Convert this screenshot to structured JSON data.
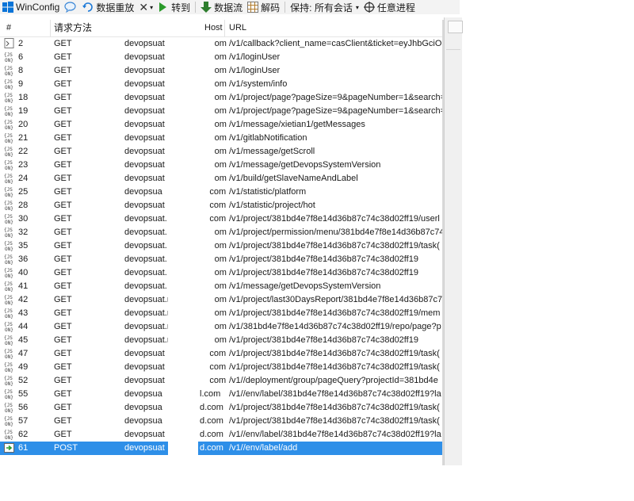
{
  "toolbar": {
    "winconfig": "WinConfig",
    "replay": "数据重放",
    "goto": "转到",
    "stream": "数据流",
    "decode": "解码",
    "keep": "保持: 所有会话",
    "process": "任意进程"
  },
  "columns": {
    "num": "#",
    "method": "请求方法",
    "host": "Host",
    "url": "URL"
  },
  "rows": [
    {
      "id": "2",
      "method": "GET",
      "host": "devopsuat",
      "host_tail": "om",
      "url": "/v1/callback?client_name=casClient&ticket=eyJhbGciOiJ",
      "icon": "page-icon"
    },
    {
      "id": "6",
      "method": "GET",
      "host": "devopsuat",
      "host_tail": "om",
      "url": "/v1/loginUser",
      "icon": "json-icon"
    },
    {
      "id": "8",
      "method": "GET",
      "host": "devopsuat",
      "host_tail": "om",
      "url": "/v1/loginUser",
      "icon": "json-icon"
    },
    {
      "id": "9",
      "method": "GET",
      "host": "devopsuat",
      "host_tail": "om",
      "url": "/v1/system/info",
      "icon": "json-icon"
    },
    {
      "id": "18",
      "method": "GET",
      "host": "devopsuat",
      "host_tail": "om",
      "url": "/v1/project/page?pageSize=9&pageNumber=1&search=",
      "icon": "json-icon"
    },
    {
      "id": "19",
      "method": "GET",
      "host": "devopsuat",
      "host_tail": "om",
      "url": "/v1/project/page?pageSize=9&pageNumber=1&search=",
      "icon": "json-icon"
    },
    {
      "id": "20",
      "method": "GET",
      "host": "devopsuat",
      "host_tail": "om",
      "url": "/v1/message/xietian1/getMessages",
      "icon": "json-icon"
    },
    {
      "id": "21",
      "method": "GET",
      "host": "devopsuat",
      "host_tail": "om",
      "url": "/v1/gitlabNotification",
      "icon": "json-icon"
    },
    {
      "id": "22",
      "method": "GET",
      "host": "devopsuat",
      "host_tail": "om",
      "url": "/v1/message/getScroll",
      "icon": "json-icon"
    },
    {
      "id": "23",
      "method": "GET",
      "host": "devopsuat",
      "host_tail": "om",
      "url": "/v1/message/getDevopsSystemVersion",
      "icon": "json-icon"
    },
    {
      "id": "24",
      "method": "GET",
      "host": "devopsuat",
      "host_tail": "om",
      "url": "/v1/build/getSlaveNameAndLabel",
      "icon": "json-icon"
    },
    {
      "id": "25",
      "method": "GET",
      "host": "devopsua",
      "host_tail": "com",
      "url": "/v1/statistic/platform",
      "icon": "json-icon"
    },
    {
      "id": "28",
      "method": "GET",
      "host": "devopsuat",
      "host_tail": "com",
      "url": "/v1/statistic/project/hot",
      "icon": "json-icon"
    },
    {
      "id": "30",
      "method": "GET",
      "host": "devopsuat.",
      "host_tail": "com",
      "url": "/v1/project/381bd4e7f8e14d36b87c74c38d02ff19/userl",
      "icon": "json-icon"
    },
    {
      "id": "32",
      "method": "GET",
      "host": "devopsuat.",
      "host_tail": "om",
      "url": "/v1/project/permission/menu/381bd4e7f8e14d36b87c74",
      "icon": "json-icon"
    },
    {
      "id": "35",
      "method": "GET",
      "host": "devopsuat.",
      "host_tail": "om",
      "url": "/v1/project/381bd4e7f8e14d36b87c74c38d02ff19/task(",
      "icon": "json-icon"
    },
    {
      "id": "36",
      "method": "GET",
      "host": "devopsuat.",
      "host_tail": "om",
      "url": "/v1/project/381bd4e7f8e14d36b87c74c38d02ff19",
      "icon": "json-icon"
    },
    {
      "id": "40",
      "method": "GET",
      "host": "devopsuat.",
      "host_tail": "om",
      "url": "/v1/project/381bd4e7f8e14d36b87c74c38d02ff19",
      "icon": "json-icon"
    },
    {
      "id": "41",
      "method": "GET",
      "host": "devopsuat.",
      "host_tail": "om",
      "url": "/v1/message/getDevopsSystemVersion",
      "icon": "json-icon"
    },
    {
      "id": "42",
      "method": "GET",
      "host": "devopsuat.m",
      "host_tail": "om",
      "url": "/v1/project/last30DaysReport/381bd4e7f8e14d36b87c7",
      "icon": "json-icon"
    },
    {
      "id": "43",
      "method": "GET",
      "host": "devopsuat.m",
      "host_tail": "om",
      "url": "/v1/project/381bd4e7f8e14d36b87c74c38d02ff19/mem",
      "icon": "json-icon"
    },
    {
      "id": "44",
      "method": "GET",
      "host": "devopsuat.m",
      "host_tail": "om",
      "url": "/v1/381bd4e7f8e14d36b87c74c38d02ff19/repo/page?p",
      "icon": "json-icon"
    },
    {
      "id": "45",
      "method": "GET",
      "host": "devopsuat.m",
      "host_tail": "om",
      "url": "/v1/project/381bd4e7f8e14d36b87c74c38d02ff19",
      "icon": "json-icon"
    },
    {
      "id": "47",
      "method": "GET",
      "host": "devopsuat",
      "host_tail": "com",
      "url": "/v1/project/381bd4e7f8e14d36b87c74c38d02ff19/task(",
      "icon": "json-icon"
    },
    {
      "id": "49",
      "method": "GET",
      "host": "devopsuat",
      "host_tail": "com",
      "url": "/v1/project/381bd4e7f8e14d36b87c74c38d02ff19/task(",
      "icon": "json-icon"
    },
    {
      "id": "52",
      "method": "GET",
      "host": "devopsuat",
      "host_tail": "com",
      "url": "/v1//deployment/group/pageQuery?projectId=381bd4e",
      "icon": "json-icon"
    },
    {
      "id": "55",
      "method": "GET",
      "host": "devopsua",
      "host_tail": "l.com",
      "url": "/v1//env/label/381bd4e7f8e14d36b87c74c38d02ff19?la",
      "icon": "json-icon"
    },
    {
      "id": "56",
      "method": "GET",
      "host": "devopsua",
      "host_tail": "d.com",
      "url": "/v1/project/381bd4e7f8e14d36b87c74c38d02ff19/task(",
      "icon": "json-icon"
    },
    {
      "id": "57",
      "method": "GET",
      "host": "devopsua",
      "host_tail": "d.com",
      "url": "/v1/project/381bd4e7f8e14d36b87c74c38d02ff19/task(",
      "icon": "json-icon"
    },
    {
      "id": "62",
      "method": "GET",
      "host": "devopsuat",
      "host_tail": "d.com",
      "url": "/v1//env/label/381bd4e7f8e14d36b87c74c38d02ff19?la",
      "icon": "json-icon"
    },
    {
      "id": "61",
      "method": "POST",
      "host": "devopsuat",
      "host_tail": "d.com",
      "url": "/v1//env/label/add",
      "icon": "post-arrow-icon",
      "selected": true
    }
  ]
}
